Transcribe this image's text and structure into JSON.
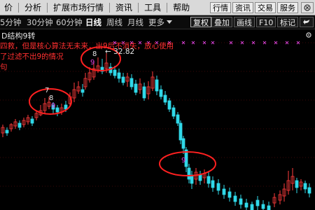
{
  "menu": {
    "items": [
      "价",
      "分析",
      "扩展市场行情",
      "资讯",
      "工具",
      "帮助"
    ],
    "right_buttons": [
      "行情",
      "资讯",
      "交易",
      "服务"
    ]
  },
  "toolbar": {
    "periods": [
      "5分钟",
      "30分钟",
      "60分钟",
      "日线",
      "周线",
      "月线",
      "更多"
    ],
    "active_period": "日线",
    "buttons": [
      "复权",
      "叠加",
      "画线",
      "F10",
      "标记"
    ]
  },
  "chart": {
    "indicator_title": "D结构9转",
    "note_lines": [
      "四救，但是核心算法无未来，出9后不消失，放心使用",
      "了过滤不出9的情况",
      "句"
    ],
    "price_label": "← 32.82",
    "count_labels": [
      {
        "text": "7",
        "color": "#e6e6e6"
      },
      {
        "text": "8",
        "color": "#e6e6e6"
      },
      {
        "text": "9",
        "color": "#e040e0"
      },
      {
        "text": "8",
        "color": "#e6e6e6"
      },
      {
        "text": "9",
        "color": "#e040e0"
      },
      {
        "text": "9",
        "color": "#e040e0"
      }
    ],
    "colors": {
      "up": "#ff3b3b",
      "down": "#30d8e8",
      "highlight_circle": "#ff2020",
      "marker": "#d040d0"
    }
  }
}
